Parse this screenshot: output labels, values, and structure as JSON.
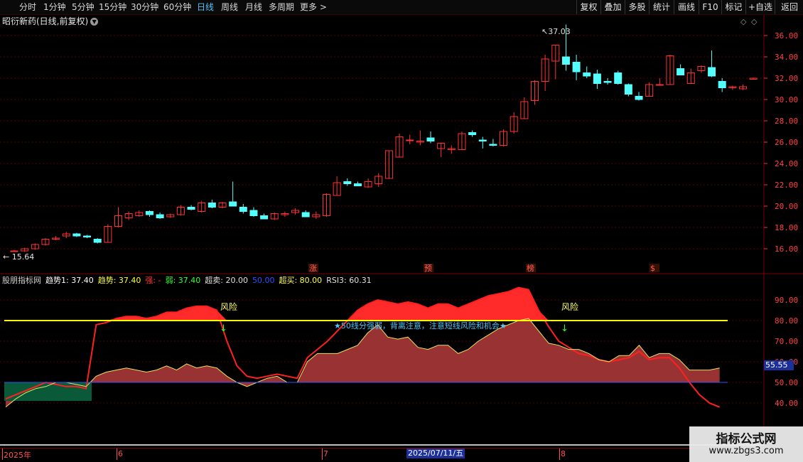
{
  "toolbar": {
    "periods": [
      "分时",
      "1分钟",
      "5分钟",
      "15分钟",
      "30分钟",
      "60分钟",
      "日线",
      "周线",
      "月线",
      "多周期",
      "更多 >"
    ],
    "active_period": "日线",
    "right_buttons": [
      "复权",
      "叠加",
      "多股",
      "统计",
      "画线",
      "F10",
      "标记",
      "+自选",
      "返回"
    ]
  },
  "stock": {
    "title": "昭衍新药(日线,前复权)",
    "max_label": "37.03",
    "min_label": "15.64",
    "event_tags": [
      "涨",
      "预",
      "榜",
      "$"
    ]
  },
  "price_axis": [
    "36.00",
    "34.00",
    "32.00",
    "30.00",
    "28.00",
    "26.00",
    "24.00",
    "22.00",
    "20.00",
    "18.00",
    "16.00"
  ],
  "indicator": {
    "name": "股朋指标网",
    "legend": [
      {
        "text": "趋势1: 37.40",
        "color": "#ffffff"
      },
      {
        "text": "趋势: 37.40",
        "color": "#ffff40"
      },
      {
        "text": "强: -",
        "color": "#ff3030"
      },
      {
        "text": "弱: 37.40",
        "color": "#30ff30"
      },
      {
        "text": "超卖: 20.00",
        "color": "#e0e0e0"
      },
      {
        "text": "50.00",
        "color": "#3050ff"
      },
      {
        "text": "超买: 80.00",
        "color": "#ffff40"
      },
      {
        "text": "RSI3: 60.31",
        "color": "#e0e0e0"
      }
    ],
    "axis": [
      "90.00",
      "80.00",
      "70.00",
      "60.00",
      "50.00",
      "40.00"
    ],
    "current_value": "55.55",
    "risk_label": "风险",
    "annotation": "★50线分强弱，背离注意，注意短线风险和机会★"
  },
  "dates": {
    "labels": [
      "2025年",
      "6",
      "7",
      "8"
    ],
    "highlight": "2025/07/11/五"
  },
  "watermark": {
    "title": "指标公式网",
    "url": "www.zbgs3.com"
  },
  "colors": {
    "up": "#ff3232",
    "down": "#54ffff",
    "grid": "#5a0000",
    "ob_line": "#ffff00"
  },
  "chart_data": {
    "type": "candlestick",
    "y_range": [
      15,
      37.5
    ],
    "candles": [
      [
        15.8,
        15.9,
        15.7,
        15.8
      ],
      [
        15.8,
        16.1,
        15.7,
        16.0
      ],
      [
        16.0,
        16.5,
        15.9,
        16.4
      ],
      [
        16.4,
        17.0,
        16.3,
        16.9
      ],
      [
        16.9,
        17.2,
        16.8,
        17.0
      ],
      [
        17.2,
        17.6,
        17.0,
        17.4
      ],
      [
        17.4,
        17.5,
        17.1,
        17.2
      ],
      [
        17.2,
        17.3,
        17.0,
        17.1
      ],
      [
        16.9,
        17.0,
        16.5,
        16.6
      ],
      [
        16.6,
        18.3,
        16.6,
        18.1
      ],
      [
        18.1,
        19.9,
        18.0,
        19.1
      ],
      [
        18.9,
        19.5,
        18.7,
        19.3
      ],
      [
        19.1,
        19.6,
        19.0,
        19.4
      ],
      [
        19.5,
        19.6,
        19.0,
        19.2
      ],
      [
        19.2,
        19.4,
        18.8,
        18.9
      ],
      [
        19.0,
        19.3,
        18.9,
        19.2
      ],
      [
        19.2,
        20.1,
        19.1,
        19.9
      ],
      [
        19.9,
        20.1,
        19.6,
        19.7
      ],
      [
        19.5,
        20.5,
        19.4,
        20.3
      ],
      [
        20.3,
        20.6,
        19.8,
        19.9
      ],
      [
        19.9,
        20.4,
        19.8,
        20.3
      ],
      [
        20.4,
        22.3,
        20.0,
        20.0
      ],
      [
        19.9,
        20.2,
        19.3,
        19.5
      ],
      [
        19.6,
        19.9,
        19.0,
        19.1
      ],
      [
        19.1,
        19.3,
        18.8,
        18.8
      ],
      [
        18.8,
        19.4,
        18.7,
        19.3
      ],
      [
        19.2,
        19.5,
        19.0,
        19.3
      ],
      [
        19.4,
        19.8,
        19.2,
        19.6
      ],
      [
        19.4,
        19.6,
        19.0,
        19.0
      ],
      [
        19.0,
        19.5,
        18.8,
        19.2
      ],
      [
        19.1,
        21.2,
        19.0,
        21.1
      ],
      [
        21.0,
        22.8,
        21.0,
        22.2
      ],
      [
        22.3,
        22.6,
        21.9,
        22.1
      ],
      [
        22.1,
        22.3,
        21.9,
        21.9
      ],
      [
        21.8,
        22.6,
        21.7,
        22.3
      ],
      [
        22.1,
        23.1,
        21.8,
        22.8
      ],
      [
        22.6,
        25.2,
        22.6,
        25.2
      ],
      [
        24.6,
        26.8,
        24.6,
        26.5
      ],
      [
        26.2,
        26.7,
        25.8,
        26.2
      ],
      [
        26.0,
        27.1,
        25.7,
        26.1
      ],
      [
        26.4,
        27.0,
        25.9,
        26.1
      ],
      [
        25.4,
        25.9,
        24.6,
        25.9
      ],
      [
        25.3,
        25.7,
        24.9,
        25.4
      ],
      [
        25.3,
        27.0,
        25.3,
        26.8
      ],
      [
        26.9,
        27.1,
        26.5,
        26.7
      ],
      [
        26.2,
        26.5,
        25.4,
        26.1
      ],
      [
        25.8,
        26.3,
        25.6,
        25.7
      ],
      [
        25.7,
        27.2,
        25.6,
        27.0
      ],
      [
        27.0,
        28.8,
        26.8,
        28.4
      ],
      [
        28.2,
        30.2,
        28.2,
        29.8
      ],
      [
        29.9,
        31.8,
        29.5,
        31.7
      ],
      [
        31.7,
        34.2,
        30.8,
        33.8
      ],
      [
        33.6,
        35.1,
        31.9,
        35.1
      ],
      [
        34.0,
        37.03,
        32.7,
        33.3
      ],
      [
        33.5,
        34.2,
        31.8,
        32.6
      ],
      [
        32.5,
        33.1,
        32.0,
        32.2
      ],
      [
        32.4,
        32.8,
        31.0,
        31.5
      ],
      [
        31.7,
        32.0,
        31.4,
        31.6
      ],
      [
        32.5,
        32.7,
        31.4,
        31.5
      ],
      [
        31.4,
        31.5,
        30.3,
        30.5
      ],
      [
        30.3,
        30.7,
        29.9,
        30.0
      ],
      [
        30.3,
        31.6,
        30.3,
        31.4
      ],
      [
        31.4,
        32.0,
        31.3,
        31.4
      ],
      [
        31.4,
        34.2,
        31.4,
        34.1
      ],
      [
        32.9,
        33.3,
        32.7,
        32.3
      ],
      [
        31.5,
        32.9,
        31.5,
        32.5
      ],
      [
        32.7,
        33.2,
        32.5,
        33.1
      ],
      [
        33.0,
        34.6,
        32.1,
        32.2
      ],
      [
        31.7,
        32.0,
        30.7,
        31.1
      ],
      [
        31.1,
        31.3,
        30.9,
        31.2
      ],
      [
        31.0,
        31.4,
        30.9,
        31.2
      ],
      [
        31.9,
        32.0,
        31.9,
        32.0
      ]
    ],
    "rsi3": [
      38,
      42,
      45,
      47,
      48,
      50,
      50,
      49,
      48,
      53,
      55,
      56,
      57,
      56,
      55,
      56,
      58,
      56,
      59,
      57,
      58,
      57,
      53,
      50,
      48,
      50,
      52,
      53,
      50,
      50,
      60,
      64,
      64,
      64,
      66,
      68,
      74,
      78,
      72,
      71,
      72,
      67,
      66,
      68,
      68,
      64,
      66,
      70,
      73,
      76,
      78,
      80,
      81,
      75,
      69,
      68,
      66,
      66,
      64,
      61,
      60,
      63,
      63,
      68,
      62,
      64,
      64,
      61,
      56,
      56,
      56,
      57
    ],
    "trend": [
      42,
      44,
      46,
      48,
      50,
      49,
      48,
      48,
      47,
      78,
      79,
      81,
      82,
      82,
      81,
      82,
      84,
      84,
      86,
      87,
      87,
      85,
      70,
      58,
      53,
      52,
      53,
      54,
      53,
      52,
      62,
      66,
      70,
      75,
      80,
      85,
      88,
      90,
      89,
      88,
      89,
      88,
      86,
      88,
      88,
      86,
      88,
      90,
      92,
      93,
      94,
      96,
      95,
      85,
      77,
      70,
      67,
      64,
      63,
      61,
      60,
      61,
      62,
      65,
      61,
      62,
      62,
      57,
      50,
      44,
      40,
      38
    ],
    "ob_level": 80,
    "mid_level": 50,
    "os_level": 20
  }
}
